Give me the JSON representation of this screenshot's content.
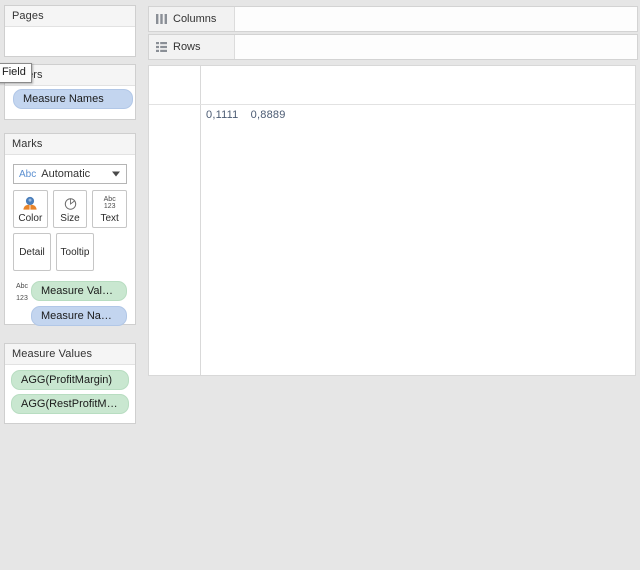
{
  "app": {
    "background_color": "#e6e6e6"
  },
  "sidebar": {
    "pages": {
      "title": "Pages",
      "items": []
    },
    "filters": {
      "title": "Filters",
      "items": [
        {
          "label": "Measure Names",
          "type": "dimension",
          "color": "#c3d5ef"
        }
      ]
    },
    "marks": {
      "title": "Marks",
      "mark_type": {
        "prefix": "Abc",
        "value": "Automatic",
        "icon": "chevron-down-icon"
      },
      "buttons": [
        {
          "label": "Color",
          "icon": "color-palette-icon"
        },
        {
          "label": "Size",
          "icon": "size-pie-icon"
        },
        {
          "label": "Text",
          "icon": "abc-123-icon"
        },
        {
          "label": "Detail",
          "icon": "detail-icon"
        },
        {
          "label": "Tooltip",
          "icon": "tooltip-icon"
        }
      ],
      "pills": [
        {
          "label": "Measure Values",
          "type": "measure",
          "color": "#c9e7d0",
          "icon": "abc-123-icon"
        },
        {
          "label": "Measure Names",
          "type": "dimension",
          "color": "#c3d5ef",
          "icon": "none"
        }
      ]
    },
    "measure_values": {
      "title": "Measure Values",
      "items": [
        {
          "label": "AGG(ProfitMargin)",
          "color": "#c9e7d0"
        },
        {
          "label": "AGG(RestProfitMargin)",
          "color": "#c9e7d0"
        }
      ]
    }
  },
  "tooltip": {
    "text": "Field"
  },
  "shelves": [
    {
      "label": "Columns",
      "icon": "columns-icon",
      "items": []
    },
    {
      "label": "Rows",
      "icon": "rows-icon",
      "items": []
    }
  ],
  "view": {
    "values": [
      "0,1111",
      "0,8889"
    ],
    "value_color": "#4b5b73"
  }
}
